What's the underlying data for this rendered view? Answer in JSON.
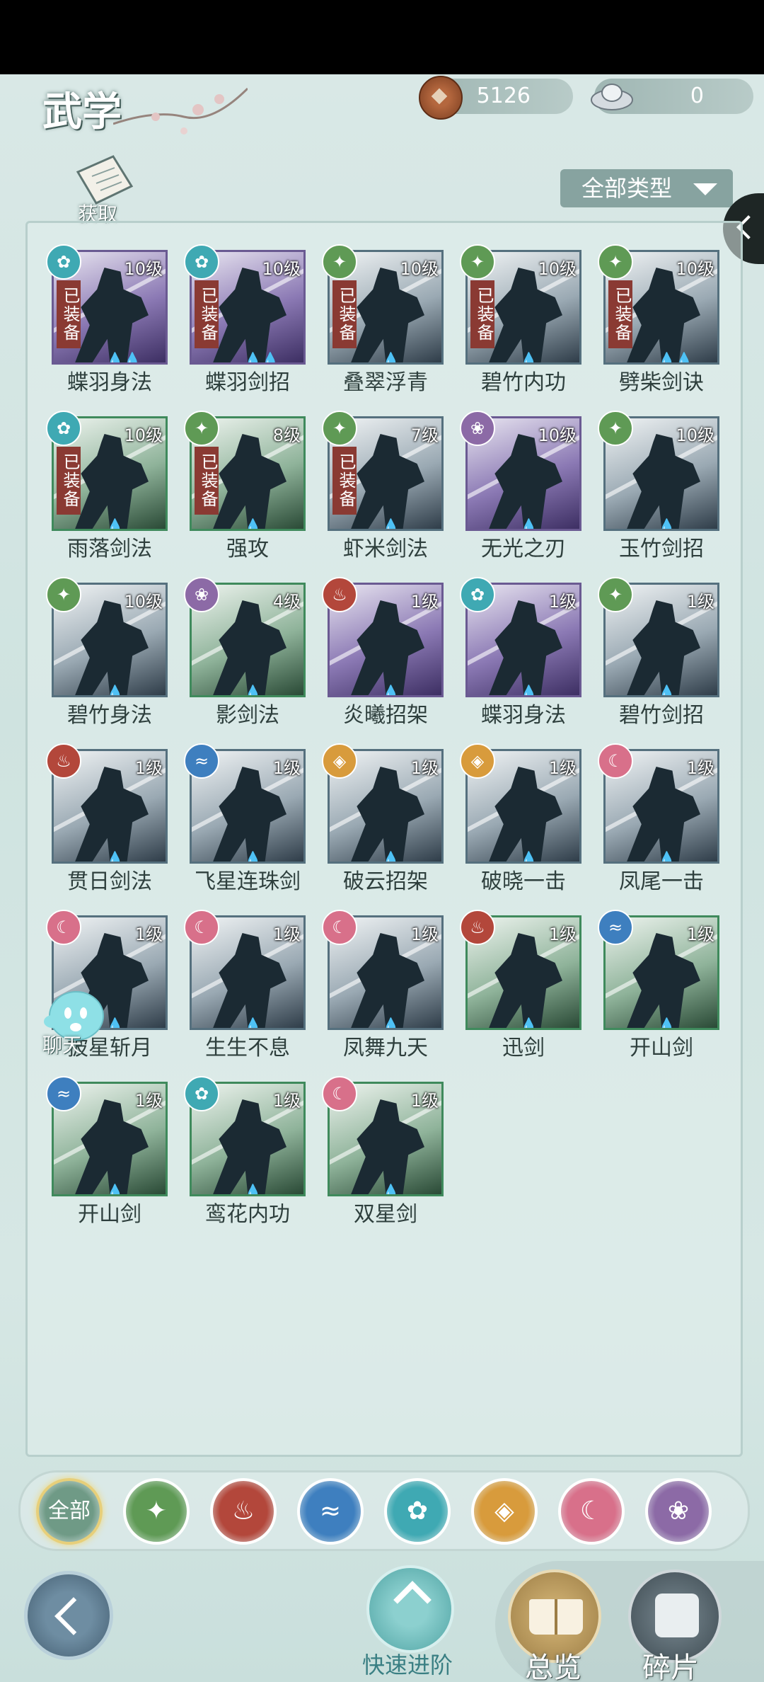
{
  "header": {
    "title": "武学",
    "copper": "5126",
    "silver": "0",
    "obtain_label": "获取",
    "filter_label": "全部类型"
  },
  "colors": {
    "wind": "#3fa9b3",
    "wood": "#5f9a55",
    "fire": "#b3473b",
    "water": "#3e7fbf",
    "gold": "#d89b3c",
    "moon": "#d8708a",
    "void": "#8c6aa6",
    "equipped_tag": "#8a3a33"
  },
  "equipped_label": "已装备",
  "skills": [
    {
      "name": "蝶羽身法",
      "level": "10级",
      "element": "wind",
      "equipped": true,
      "frame": "purple",
      "drops": "💧💧"
    },
    {
      "name": "蝶羽剑招",
      "level": "10级",
      "element": "wind",
      "equipped": true,
      "frame": "purple",
      "drops": "💧💧"
    },
    {
      "name": "叠翠浮青",
      "level": "10级",
      "element": "wood",
      "equipped": true,
      "frame": "blue",
      "drops": "💧"
    },
    {
      "name": "碧竹内功",
      "level": "10级",
      "element": "wood",
      "equipped": true,
      "frame": "blue",
      "drops": "💧"
    },
    {
      "name": "劈柴剑诀",
      "level": "10级",
      "element": "wood",
      "equipped": true,
      "frame": "blue",
      "drops": "💧💧"
    },
    {
      "name": "雨落剑法",
      "level": "10级",
      "element": "wind",
      "equipped": true,
      "frame": "green",
      "drops": "💧"
    },
    {
      "name": "强攻",
      "level": "8级",
      "element": "wood",
      "equipped": true,
      "frame": "green",
      "drops": "💧"
    },
    {
      "name": "虾米剑法",
      "level": "7级",
      "element": "wood",
      "equipped": true,
      "frame": "blue",
      "drops": "💧"
    },
    {
      "name": "无光之刃",
      "level": "10级",
      "element": "void",
      "equipped": false,
      "frame": "purple",
      "drops": "💧"
    },
    {
      "name": "玉竹剑招",
      "level": "10级",
      "element": "wood",
      "equipped": false,
      "frame": "blue",
      "drops": "💧"
    },
    {
      "name": "碧竹身法",
      "level": "10级",
      "element": "wood",
      "equipped": false,
      "frame": "blue",
      "drops": "💧"
    },
    {
      "name": "影剑法",
      "level": "4级",
      "element": "void",
      "equipped": false,
      "frame": "green",
      "drops": "💧"
    },
    {
      "name": "炎曦招架",
      "level": "1级",
      "element": "fire",
      "equipped": false,
      "frame": "purple",
      "drops": "💧"
    },
    {
      "name": "蝶羽身法",
      "level": "1级",
      "element": "wind",
      "equipped": false,
      "frame": "purple",
      "drops": "💧"
    },
    {
      "name": "碧竹剑招",
      "level": "1级",
      "element": "wood",
      "equipped": false,
      "frame": "blue",
      "drops": "💧"
    },
    {
      "name": "贯日剑法",
      "level": "1级",
      "element": "fire",
      "equipped": false,
      "frame": "blue",
      "drops": "💧"
    },
    {
      "name": "飞星连珠剑",
      "level": "1级",
      "element": "water",
      "equipped": false,
      "frame": "blue",
      "drops": "💧"
    },
    {
      "name": "破云招架",
      "level": "1级",
      "element": "gold",
      "equipped": false,
      "frame": "blue",
      "drops": "💧"
    },
    {
      "name": "破晓一击",
      "level": "1级",
      "element": "gold",
      "equipped": false,
      "frame": "blue",
      "drops": "💧"
    },
    {
      "name": "凤尾一击",
      "level": "1级",
      "element": "moon",
      "equipped": false,
      "frame": "blue",
      "drops": "💧"
    },
    {
      "name": "披星斩月",
      "level": "1级",
      "element": "moon",
      "equipped": false,
      "frame": "blue",
      "drops": "💧"
    },
    {
      "name": "生生不息",
      "level": "1级",
      "element": "moon",
      "equipped": false,
      "frame": "blue",
      "drops": "💧"
    },
    {
      "name": "凤舞九天",
      "level": "1级",
      "element": "moon",
      "equipped": false,
      "frame": "blue",
      "drops": "💧"
    },
    {
      "name": "迅剑",
      "level": "1级",
      "element": "fire",
      "equipped": false,
      "frame": "green",
      "drops": "💧"
    },
    {
      "name": "开山剑",
      "level": "1级",
      "element": "water",
      "equipped": false,
      "frame": "green",
      "drops": "💧"
    },
    {
      "name": "开山剑",
      "level": "1级",
      "element": "water",
      "equipped": false,
      "frame": "green",
      "drops": "💧"
    },
    {
      "name": "鸾花内功",
      "level": "1级",
      "element": "wind",
      "equipped": false,
      "frame": "green",
      "drops": "💧"
    },
    {
      "name": "双星剑",
      "level": "1级",
      "element": "moon",
      "equipped": false,
      "frame": "green",
      "drops": "💧"
    }
  ],
  "chat_label": "聊天",
  "element_filter": {
    "all_label": "全部",
    "items": [
      {
        "name": "all",
        "icon": "all-icon"
      },
      {
        "name": "wood",
        "icon": "wood-element-icon"
      },
      {
        "name": "fire",
        "icon": "fire-element-icon"
      },
      {
        "name": "water",
        "icon": "water-element-icon"
      },
      {
        "name": "wind",
        "icon": "wind-element-icon"
      },
      {
        "name": "gold",
        "icon": "gold-element-icon"
      },
      {
        "name": "moon",
        "icon": "moon-element-icon"
      },
      {
        "name": "void",
        "icon": "void-element-icon"
      }
    ]
  },
  "bottom": {
    "quick_label": "快速进阶",
    "overview_label": "总览",
    "fragments_label": "碎片"
  }
}
